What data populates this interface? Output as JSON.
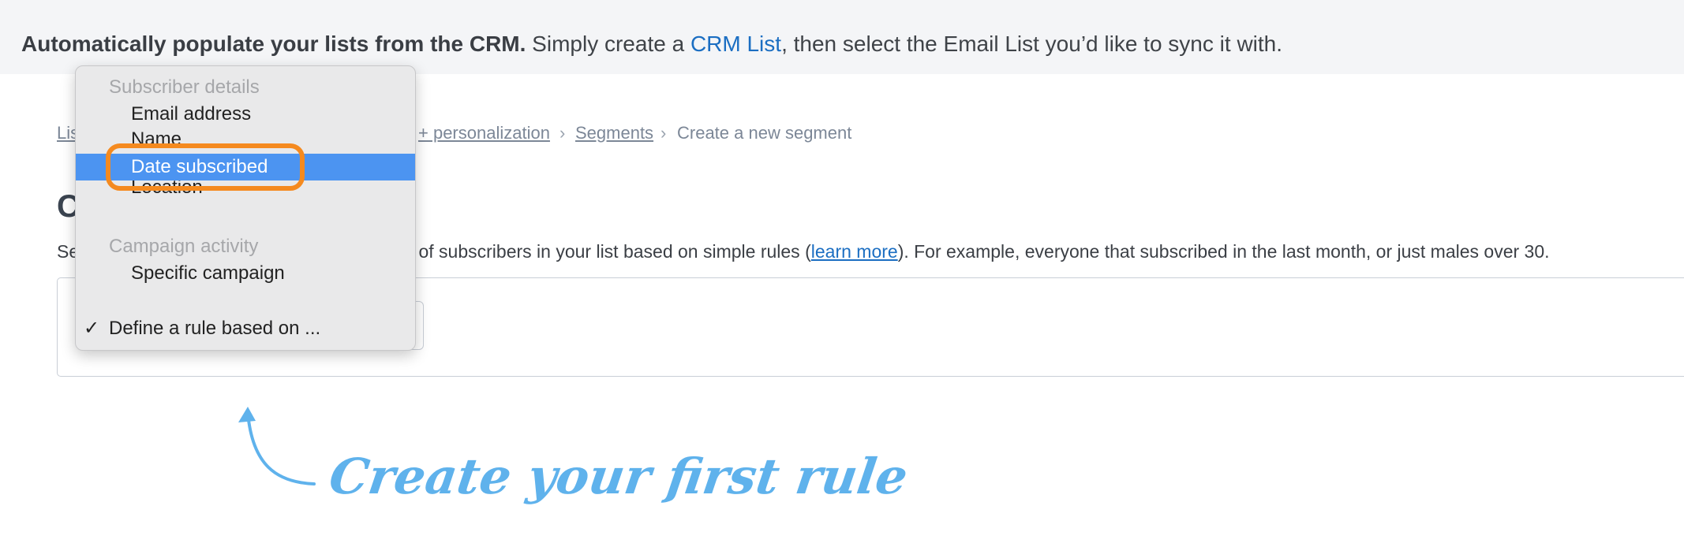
{
  "banner": {
    "bold": "Automatically populate your lists from the CRM.",
    "pre_link": " Simply create a ",
    "link": "CRM List",
    "post_link": ", then select the Email List you’d like to sync it with."
  },
  "breadcrumb": {
    "first_partial": "Lis",
    "personalization": "+ personalization",
    "segments": "Segments",
    "current": "Create a new segment",
    "separator": "›"
  },
  "page": {
    "title_partial": "C",
    "desc_lead": "Se",
    "desc_text": "pes of subscribers in your list based on simple rules (",
    "learn_more": "learn more",
    "desc_tail": "). For example, everyone that subscribed in the last month, or just males over 30."
  },
  "dropdown": {
    "group1": "Subscriber details",
    "items1": [
      "Email address",
      "Name",
      "Date subscribed",
      "Location"
    ],
    "group2": "Campaign activity",
    "items2": [
      "Specific campaign"
    ],
    "checked_item": "Define a rule based on ...",
    "check_icon": "✓",
    "selected": "Date subscribed"
  },
  "annotation": {
    "text": "Create your first rule",
    "color": "#5fb2ec"
  },
  "colors": {
    "link": "#1b6ec2",
    "highlight": "#4c94f1",
    "callout": "#f58a1f"
  }
}
